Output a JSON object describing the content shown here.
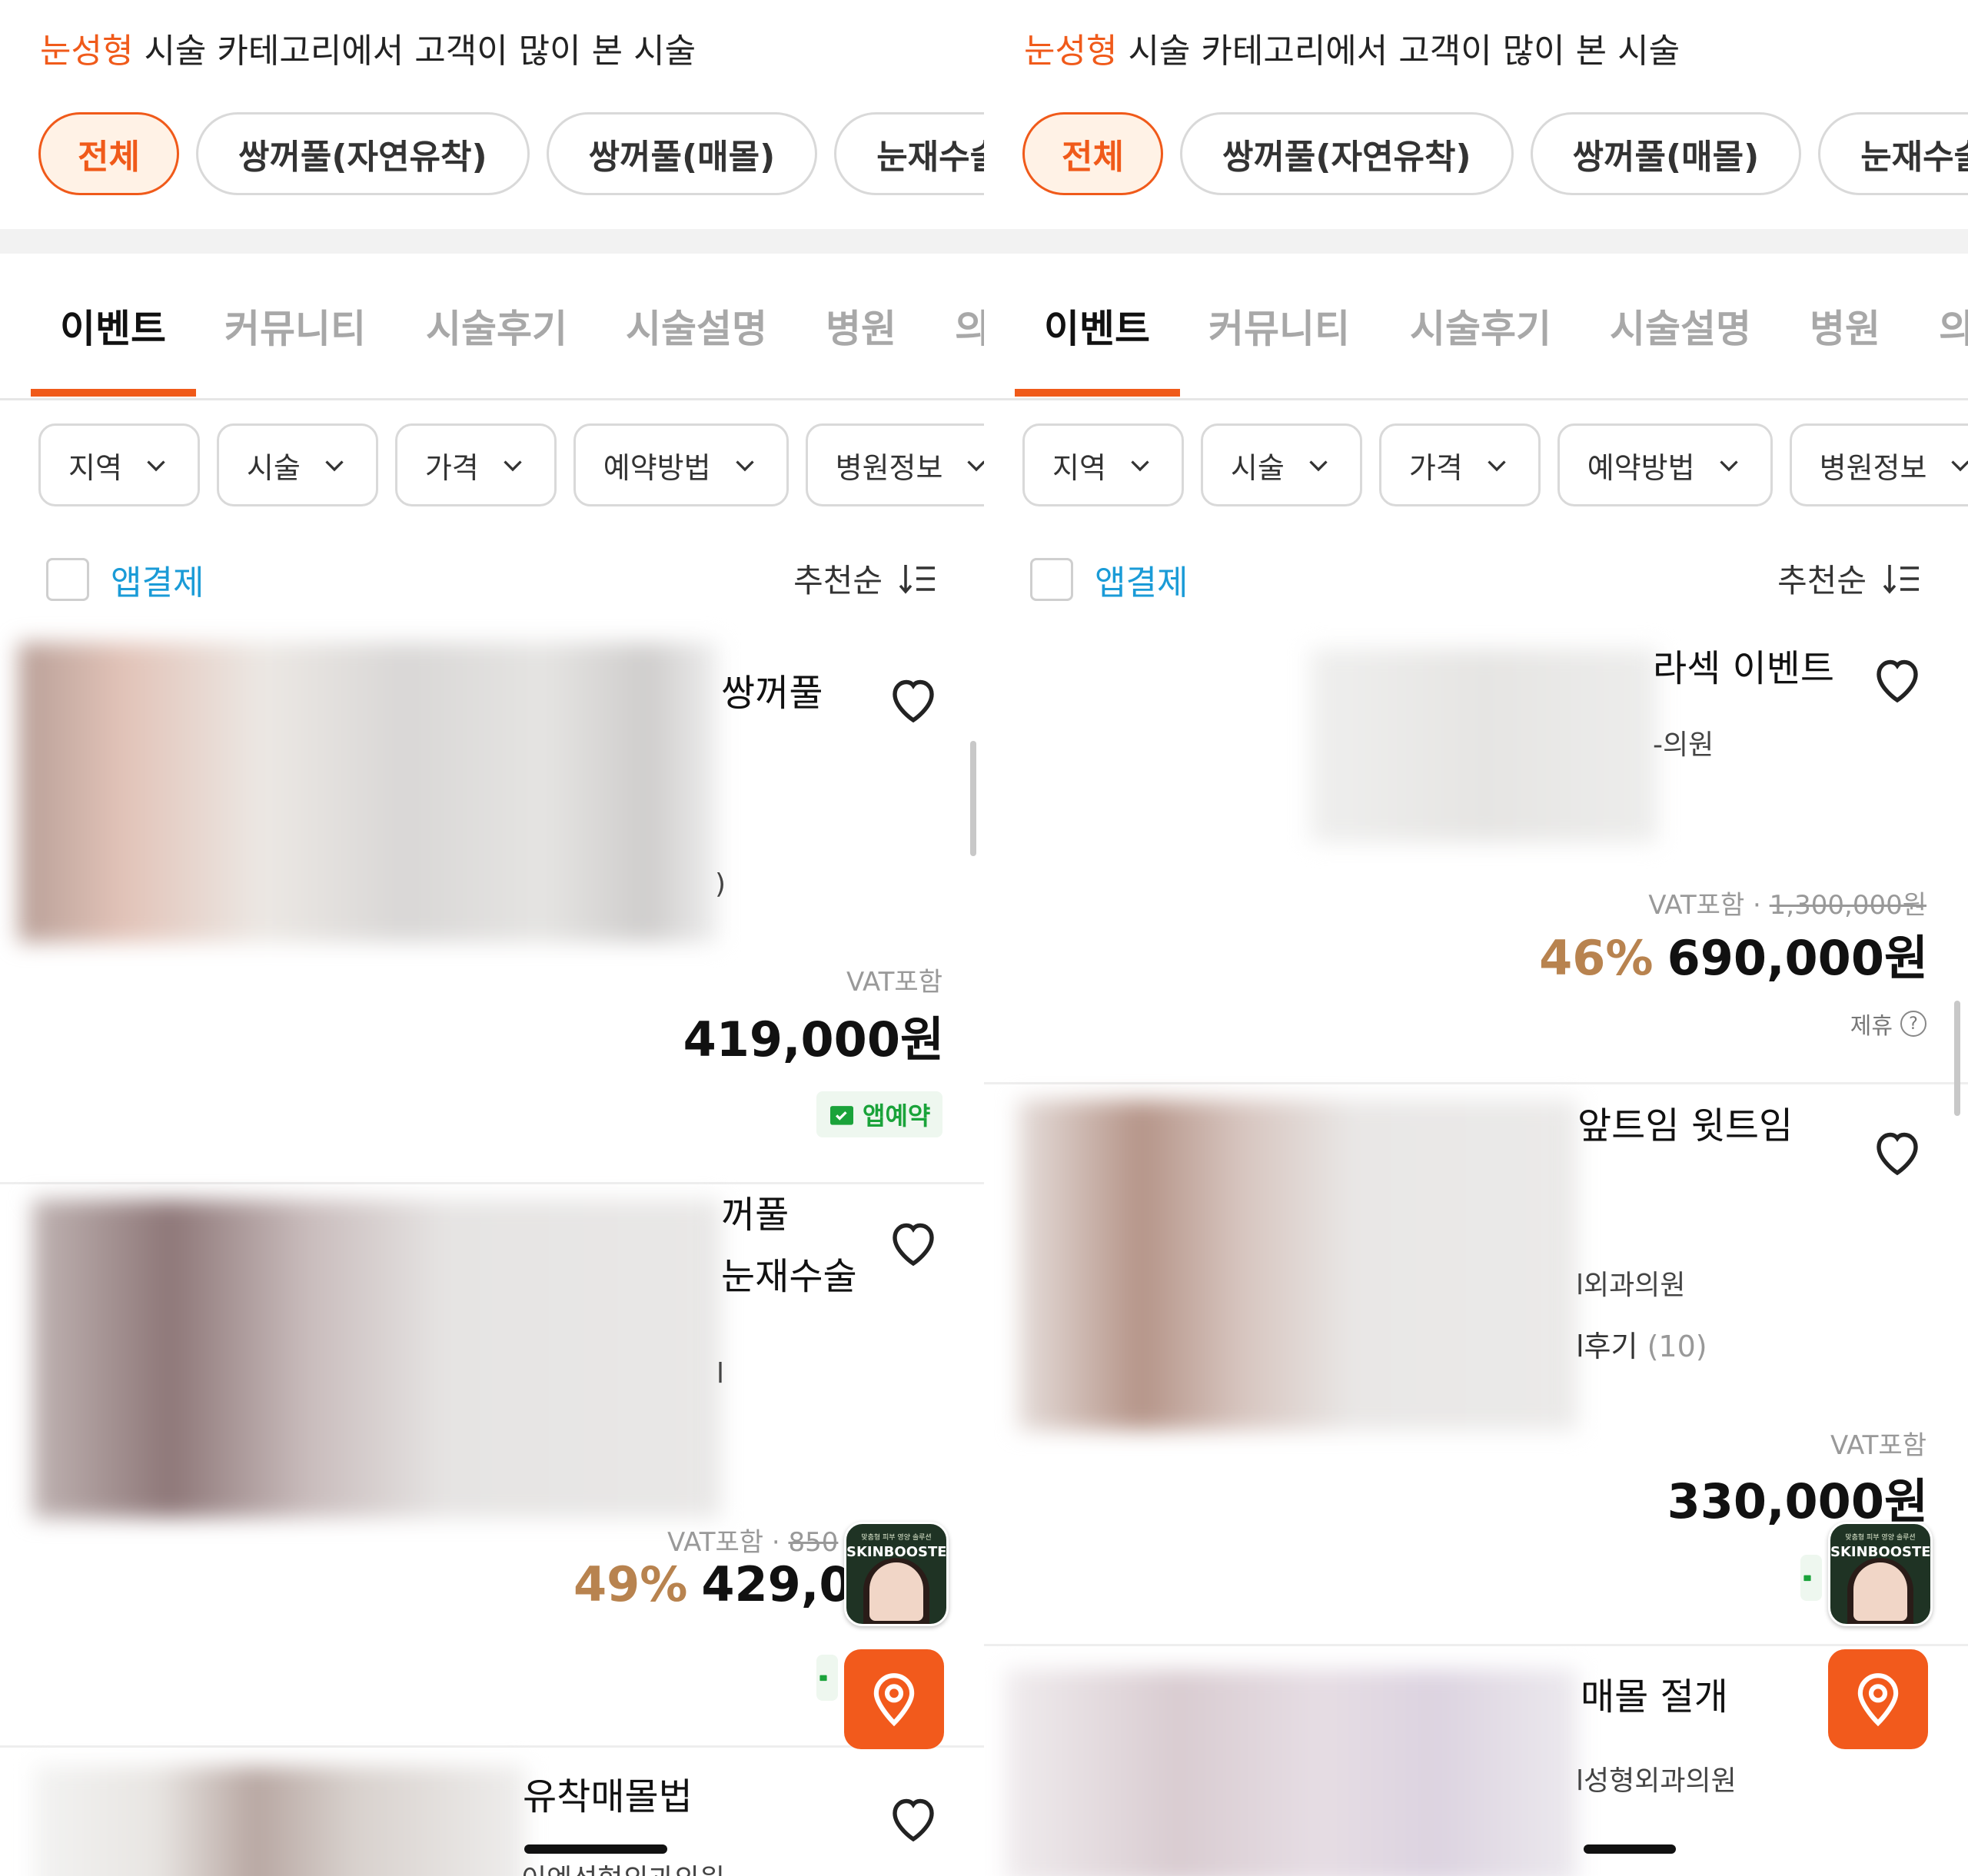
{
  "headline": {
    "highlight": "눈성형",
    "rest": " 시술 카테고리에서 고객이 많이 본 시술"
  },
  "chips": [
    "전체",
    "쌍꺼풀(자연유착)",
    "쌍꺼풀(매몰)",
    "눈재수술"
  ],
  "tabs": [
    "이벤트",
    "커뮤니티",
    "시술후기",
    "시술설명",
    "병원",
    "의"
  ],
  "filters": [
    "지역",
    "시술",
    "가격",
    "예약방법",
    "병원정보"
  ],
  "app_pay_label": "앱결제",
  "sort_label": "추천순",
  "ad_banner": {
    "top": "맞춤형 피부 영양 솔루션",
    "name": "SKINBOOSTER"
  },
  "left_cards": [
    {
      "title": "쌍꺼풀",
      "sub": ")",
      "vat": "VAT포함",
      "price": "419,000원",
      "badge": "앱예약"
    },
    {
      "title1": "꺼풀",
      "title2": "눈재수술",
      "sub": "l",
      "vat": "VAT포함 · ",
      "original": "850",
      "discount": "49%",
      "price": "429,0"
    },
    {
      "title": "유착매몰법",
      "sub": "이엔성형외과의원"
    }
  ],
  "right_cards": [
    {
      "title": "라섹 이벤트",
      "sub": "-의원",
      "vat": "VAT포함 · ",
      "original": "1,300,000원",
      "discount": "46%",
      "price": "690,000원",
      "partner": "제휴",
      "partner_icon": "?"
    },
    {
      "title": "앞트임 윗트임",
      "sub": "l외과의원",
      "reviews": "l후기",
      "review_count": "(10)",
      "vat": "VAT포함",
      "price": "330,000원"
    },
    {
      "title": "매몰 절개",
      "sub": "l성형외과의원"
    }
  ]
}
